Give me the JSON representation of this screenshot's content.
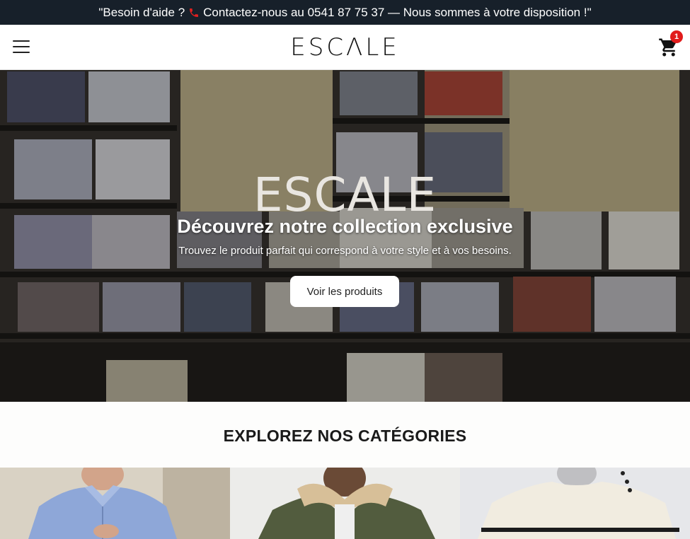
{
  "topbar": {
    "text_before": "\"Besoin d'aide ?",
    "text_after": "Contactez-nous au 0541 87 75 37 — Nous sommes à votre disposition !\"",
    "icon": "phone-icon"
  },
  "header": {
    "logo": "ESCΛLE",
    "menu_icon": "hamburger-menu-icon",
    "cart_icon": "shopping-cart-icon",
    "cart_count": "1"
  },
  "hero": {
    "title": "ESCALE",
    "subtitle": "Découvrez notre collection exclusive",
    "description": "Trouvez le produit parfait qui correspond à votre style et à vos besoins.",
    "button_label": "Voir les produits"
  },
  "categories": {
    "heading": "EXPLOREZ NOS CATÉGORIES",
    "items": [
      {
        "image": "blue-shirt-photo"
      },
      {
        "image": "bomber-jacket-photo"
      },
      {
        "image": "striped-sweater-photo"
      }
    ]
  },
  "colors": {
    "topbar_bg": "#17202a",
    "cart_badge": "#e11b1b",
    "phone_icon": "#e02020"
  }
}
